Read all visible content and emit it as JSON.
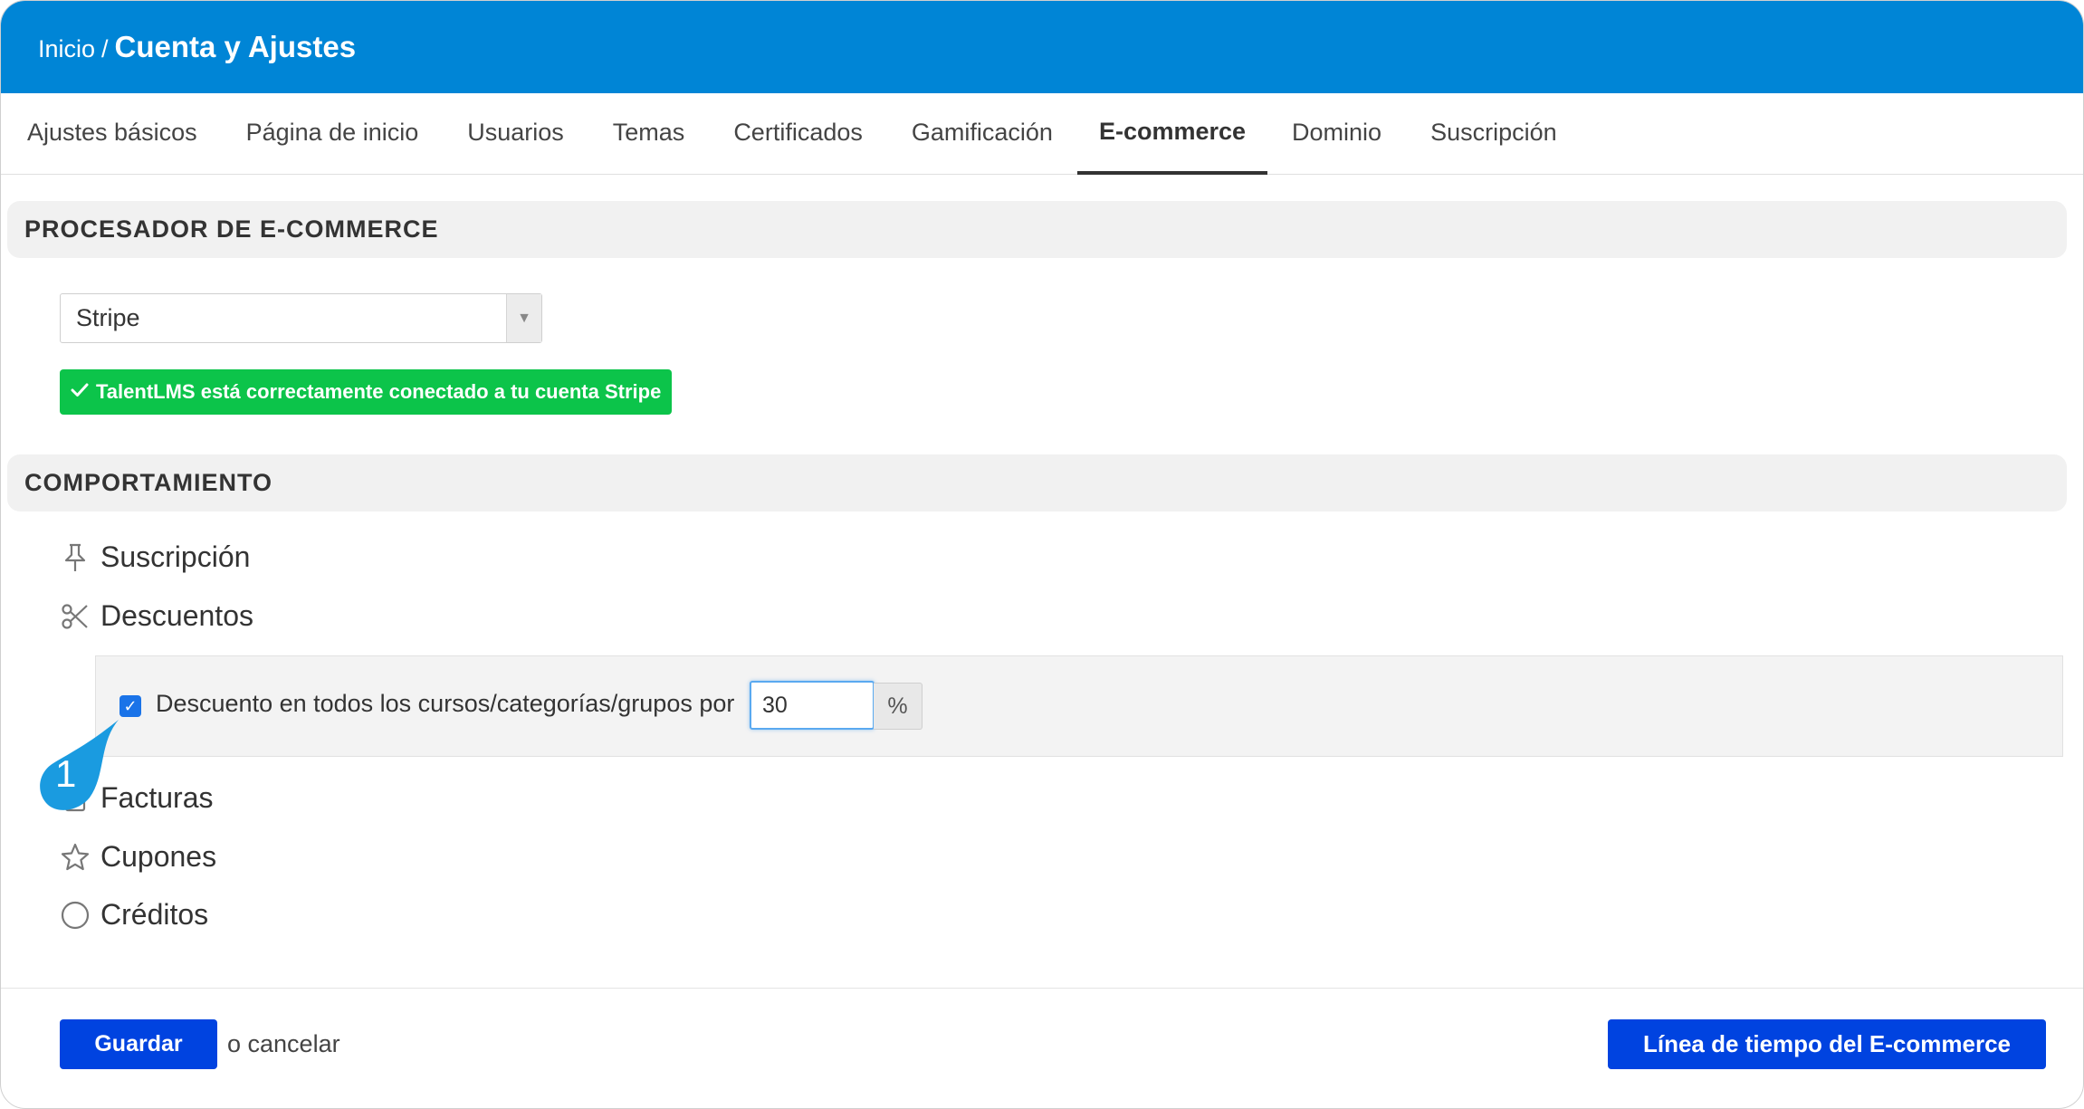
{
  "header": {
    "breadcrumb_home": "Inicio",
    "breadcrumb_sep": "/",
    "title": "Cuenta y Ajustes"
  },
  "tabs": [
    {
      "label": "Ajustes básicos",
      "active": false
    },
    {
      "label": "Página de inicio",
      "active": false
    },
    {
      "label": "Usuarios",
      "active": false
    },
    {
      "label": "Temas",
      "active": false
    },
    {
      "label": "Certificados",
      "active": false
    },
    {
      "label": "Gamificación",
      "active": false
    },
    {
      "label": "E-commerce",
      "active": true
    },
    {
      "label": "Dominio",
      "active": false
    },
    {
      "label": "Suscripción",
      "active": false
    }
  ],
  "processor": {
    "heading": "PROCESADOR DE E-COMMERCE",
    "selected": "Stripe",
    "status_icon": "check-icon",
    "status_text": "TalentLMS está correctamente conectado a tu cuenta Stripe",
    "status_color": "#0cc44a"
  },
  "behavior": {
    "heading": "COMPORTAMIENTO",
    "items": [
      {
        "label": "Suscripción",
        "icon": "pin-icon"
      },
      {
        "label": "Descuentos",
        "icon": "scissors-icon"
      },
      {
        "label": "Facturas",
        "icon": "invoice-icon"
      },
      {
        "label": "Cupones",
        "icon": "star-icon"
      },
      {
        "label": "Créditos",
        "icon": "circle-icon"
      }
    ],
    "discount": {
      "checked": true,
      "label": "Descuento en todos los cursos/categorías/grupos por",
      "value": "30",
      "unit": "%"
    }
  },
  "callout": {
    "number": "1",
    "color": "#1a9be0"
  },
  "footer": {
    "save_label": "Guardar",
    "cancel_text": "o cancelar",
    "timeline_label": "Línea de tiempo del E-commerce",
    "button_color": "#0043e0"
  },
  "colors": {
    "header": "#0085d6"
  }
}
